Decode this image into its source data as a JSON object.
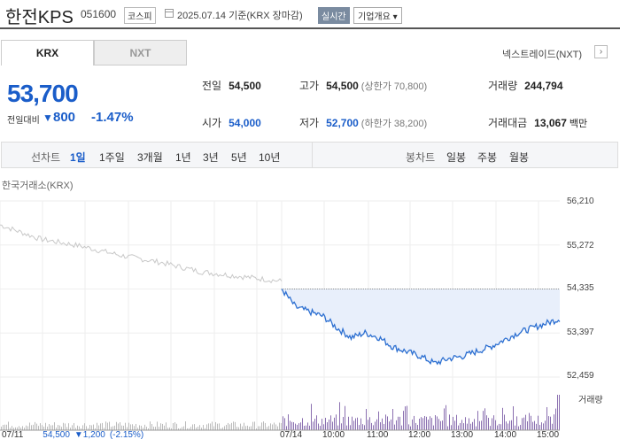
{
  "header": {
    "name": "한전KPS",
    "code": "051600",
    "market": "코스피",
    "date": "2025.07.14 기준(KRX 장마감)",
    "realtime": "실시간",
    "company_info": "기업개요 ▾"
  },
  "tabs": {
    "krx": "KRX",
    "nxt": "NXT"
  },
  "nxt_link": "넥스트레이드(NXT)",
  "nxt_arrow": "›",
  "price": {
    "current": "53,700",
    "diff_label": "전일대비",
    "diff_triangle": "▼",
    "diff_value": "800",
    "diff_pct": "-1.47%",
    "color": "#1a5dc9"
  },
  "stats": {
    "prev_close_k": "전일",
    "prev_close_v": "54,500",
    "high_k": "고가",
    "high_v": "54,500",
    "upper_limit": "(상한가 70,800)",
    "volume_k": "거래량",
    "volume_v": "244,794",
    "open_k": "시가",
    "open_v": "54,000",
    "low_k": "저가",
    "low_v": "52,700",
    "lower_limit": "(하한가 38,200)",
    "amount_k": "거래대금",
    "amount_v": "13,067",
    "amount_unit": "백만"
  },
  "periods": {
    "line_label": "선차트",
    "items": [
      "1일",
      "1주일",
      "3개월",
      "1년",
      "3년",
      "5년",
      "10년"
    ],
    "candle_label": "봉차트",
    "candle_items": [
      "일봉",
      "주봉",
      "월봉"
    ]
  },
  "chart_title": "한국거래소(KRX)",
  "y_ticks": [
    "56,210",
    "55,272",
    "54,335",
    "53,397",
    "52,459"
  ],
  "x_ticks": [
    "07/14",
    "10:00",
    "11:00",
    "12:00",
    "13:00",
    "14:00",
    "15:00"
  ],
  "volume_legend": "거래량",
  "bottom_info": {
    "date": "07/11",
    "price": "54,500",
    "change": "▼1,200",
    "pct": "(-2.15%)"
  },
  "chart_data": {
    "type": "line",
    "ylim": [
      52459,
      56210
    ],
    "prev_day": [
      [
        "07/11 09:00",
        55700
      ],
      [
        "07/11 10:00",
        55400
      ],
      [
        "07/11 11:00",
        55250
      ],
      [
        "07/11 12:00",
        55050
      ],
      [
        "07/11 13:00",
        54900
      ],
      [
        "07/11 14:00",
        54700
      ],
      [
        "07/11 15:00",
        54600
      ],
      [
        "07/11 15:30",
        54500
      ]
    ],
    "today": [
      [
        "09:00",
        54335
      ],
      [
        "09:10",
        53950
      ],
      [
        "09:20",
        53850
      ],
      [
        "09:30",
        53750
      ],
      [
        "09:45",
        53500
      ],
      [
        "10:00",
        53300
      ],
      [
        "10:20",
        53400
      ],
      [
        "10:40",
        53300
      ],
      [
        "11:00",
        53100
      ],
      [
        "11:20",
        53000
      ],
      [
        "11:40",
        52900
      ],
      [
        "12:00",
        52750
      ],
      [
        "12:20",
        52850
      ],
      [
        "12:40",
        52900
      ],
      [
        "13:00",
        53000
      ],
      [
        "13:30",
        53100
      ],
      [
        "14:00",
        53250
      ],
      [
        "14:20",
        53400
      ],
      [
        "14:40",
        53500
      ],
      [
        "15:00",
        53600
      ],
      [
        "15:20",
        53700
      ]
    ]
  }
}
